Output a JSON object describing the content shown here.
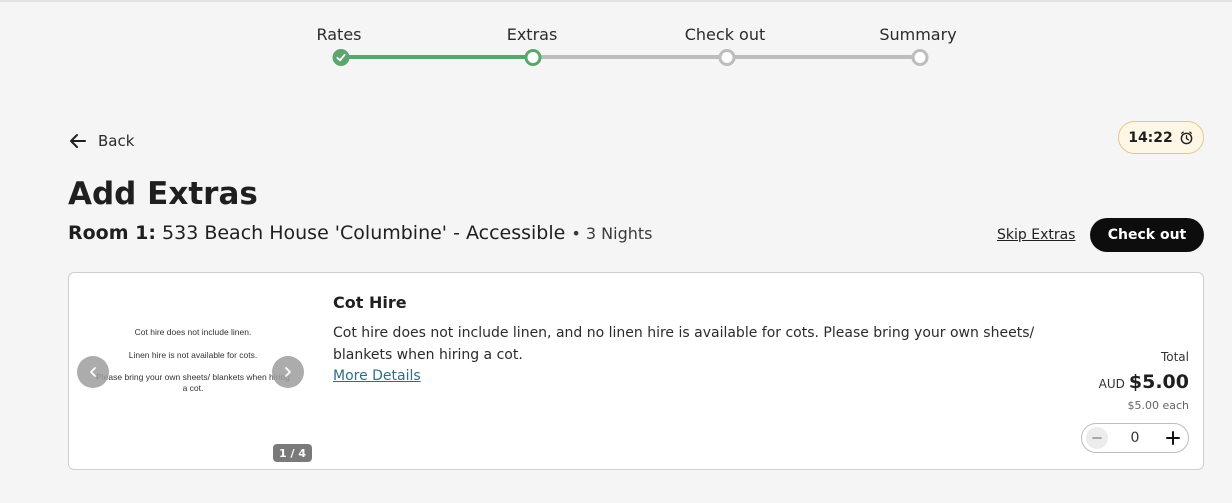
{
  "stepper": {
    "steps": [
      {
        "label": "Rates",
        "state": "done"
      },
      {
        "label": "Extras",
        "state": "current"
      },
      {
        "label": "Check out",
        "state": "todo"
      },
      {
        "label": "Summary",
        "state": "todo"
      }
    ],
    "colors": {
      "done": "#5aa66c",
      "todo": "#bdbdbd"
    }
  },
  "nav": {
    "back_label": "Back",
    "back_icon": "arrow-left-icon"
  },
  "timer": {
    "value": "14:22",
    "icon": "timer-icon"
  },
  "page": {
    "title": "Add Extras",
    "room_label": "Room 1:",
    "room_name": "533 Beach House 'Columbine' - Accessible",
    "nights": "• 3 Nights"
  },
  "actions": {
    "skip_label": "Skip Extras",
    "checkout_label": "Check out"
  },
  "extra": {
    "image_text": [
      "Cot hire does not include linen.",
      "Linen hire is not available for cots.",
      "Please bring your own sheets/ blankets when hiring a cot."
    ],
    "image_counter": "1 / 4",
    "title": "Cot Hire",
    "description": "Cot hire does not include linen, and no linen hire is available for cots. Please bring your own sheets/ blankets when hiring a cot.",
    "more_label": "More Details",
    "total_label": "Total",
    "currency": "AUD",
    "price": "$5.00",
    "each": "$5.00 each",
    "quantity": "0"
  }
}
